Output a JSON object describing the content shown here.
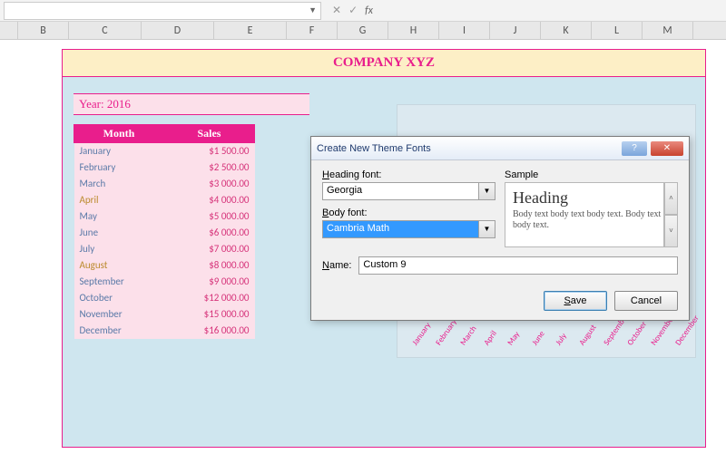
{
  "columns": [
    "B",
    "C",
    "D",
    "E",
    "F",
    "G",
    "H",
    "I",
    "J",
    "K",
    "L",
    "M"
  ],
  "title": "COMPANY XYZ",
  "year_label": "Year: 2016",
  "table": {
    "headers": [
      "Month",
      "Sales"
    ],
    "rows": [
      {
        "month": "January",
        "sales": "$1 500.00"
      },
      {
        "month": "February",
        "sales": "$2 500.00"
      },
      {
        "month": "March",
        "sales": "$3 000.00"
      },
      {
        "month": "April",
        "sales": "$4 000.00"
      },
      {
        "month": "May",
        "sales": "$5 000.00"
      },
      {
        "month": "June",
        "sales": "$6 000.00"
      },
      {
        "month": "July",
        "sales": "$7 000.00"
      },
      {
        "month": "August",
        "sales": "$8 000.00"
      },
      {
        "month": "September",
        "sales": "$9 000.00"
      },
      {
        "month": "October",
        "sales": "$12 000.00"
      },
      {
        "month": "November",
        "sales": "$15 000.00"
      },
      {
        "month": "December",
        "sales": "$16 000.00"
      }
    ]
  },
  "chart_months": [
    "January",
    "February",
    "March",
    "April",
    "May",
    "June",
    "July",
    "August",
    "September",
    "October",
    "November",
    "December"
  ],
  "dialog": {
    "title": "Create New Theme Fonts",
    "heading_label": "Heading font:",
    "heading_value": "Georgia",
    "body_label": "Body font:",
    "body_value": "Cambria Math",
    "sample_label": "Sample",
    "sample_heading": "Heading",
    "sample_body": "Body text body text body text. Body text body text.",
    "name_label": "Name:",
    "name_value": "Custom 9",
    "save": "Save",
    "cancel": "Cancel"
  },
  "fx": "fx"
}
